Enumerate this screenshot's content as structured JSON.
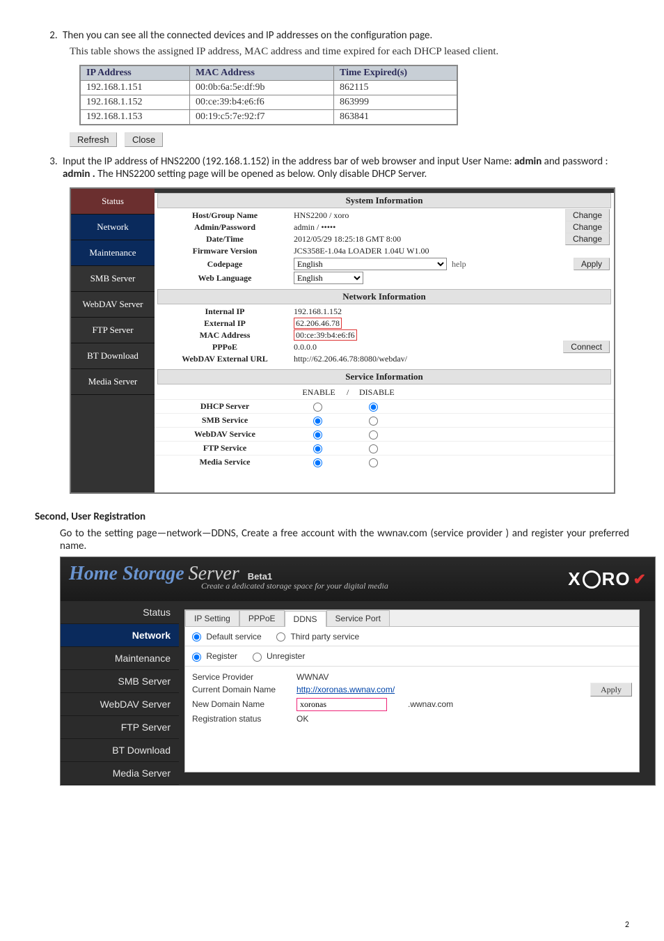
{
  "doc": {
    "step2_text": "Then you can see all the connected devices and IP addresses on the configuration page.",
    "step2_sub": "This table shows the assigned IP address, MAC address and time expired for each DHCP leased client.",
    "step3_pre": "Input the IP address of HNS2200 (192.168.1.152) in the address bar of web browser and input User Name: ",
    "step3_user": "admin",
    "step3_mid": " and password : ",
    "step3_pass": "admin .",
    "step3_post": "  The HNS2200 setting page will be opened as below. Only disable DHCP Server.",
    "section2_heading": "Second, User Registration",
    "section2_body": "Go to the setting page—network—DDNS, Create a free account with the wwnav.com (service provider ) and register your preferred name.",
    "page_number": "2"
  },
  "lease_table": {
    "headers": [
      "IP Address",
      "MAC Address",
      "Time Expired(s)"
    ],
    "rows": [
      [
        "192.168.1.151",
        "00:0b:6a:5e:df:9b",
        "862115"
      ],
      [
        "192.168.1.152",
        "00:ce:39:b4:e6:f6",
        "863999"
      ],
      [
        "192.168.1.153",
        "00:19:c5:7e:92:f7",
        "863841"
      ]
    ],
    "refresh": "Refresh",
    "close": "Close"
  },
  "hns": {
    "tabs": [
      "Status",
      "Network",
      "Maintenance",
      "SMB Server",
      "WebDAV Server",
      "FTP Server",
      "BT Download",
      "Media Server"
    ],
    "bars": {
      "sys": "System Information",
      "net": "Network Information",
      "svc": "Service Information"
    },
    "sys": {
      "host_k": "Host/Group Name",
      "host_v": "HNS2200 / xoro",
      "cred_k": "Admin/Password",
      "cred_v": "admin / •••••",
      "dt_k": "Date/Time",
      "dt_v": "2012/05/29 18:25:18 GMT 8:00",
      "fw_k": "Firmware Version",
      "fw_v": "JCS358E-1.04a LOADER 1.04U W1.00",
      "cp_k": "Codepage",
      "cp_opt": "English",
      "help": "help",
      "wl_k": "Web Language",
      "wl_opt": "English",
      "change": "Change",
      "apply": "Apply"
    },
    "net": {
      "iip_k": "Internal IP",
      "iip_v": "192.168.1.152",
      "eip_k": "External IP",
      "eip_v": "62.206.46.78",
      "mac_k": "MAC Address",
      "mac_v": "00:ce:39:b4:e6:f6",
      "ppp_k": "PPPoE",
      "ppp_v": "0.0.0.0",
      "wdv_k": "WebDAV External URL",
      "wdv_v": "http://62.206.46.78:8080/webdav/",
      "connect": "Connect"
    },
    "svc": {
      "enable": "ENABLE",
      "disable": "DISABLE",
      "sep": " / ",
      "rows": [
        {
          "k": "DHCP Server",
          "en": false,
          "dis": true
        },
        {
          "k": "SMB Service",
          "en": true,
          "dis": false
        },
        {
          "k": "WebDAV Service",
          "en": true,
          "dis": false
        },
        {
          "k": "FTP Service",
          "en": true,
          "dis": false
        },
        {
          "k": "Media Service",
          "en": true,
          "dis": false
        }
      ]
    }
  },
  "xoro": {
    "brand1": "Home Storage",
    "brand2": "Server",
    "beta": "Beta1",
    "tagline": "Create a dedicated storage space for your digital media",
    "logo": "XORO",
    "side": [
      "Status",
      "Network",
      "Maintenance",
      "SMB Server",
      "WebDAV Server",
      "FTP Server",
      "BT Download",
      "Media Server"
    ],
    "tabs": {
      "ip": "IP Setting",
      "pppoe": "PPPoE",
      "ddns": "DDNS",
      "port": "Service Port"
    },
    "svc": {
      "default": "Default service",
      "third": "Third party service"
    },
    "reg": {
      "register": "Register",
      "unregister": "Unregister"
    },
    "rows": {
      "sp_k": "Service Provider",
      "sp_v": "WWNAV",
      "cd_k": "Current Domain Name",
      "cd_v": "http://xoronas.wwnav.com/",
      "nd_k": "New Domain Name",
      "nd_v": "xoronas",
      "nd_suffix": ".wwnav.com",
      "rs_k": "Registration status",
      "rs_v": "OK",
      "apply": "Apply"
    }
  }
}
